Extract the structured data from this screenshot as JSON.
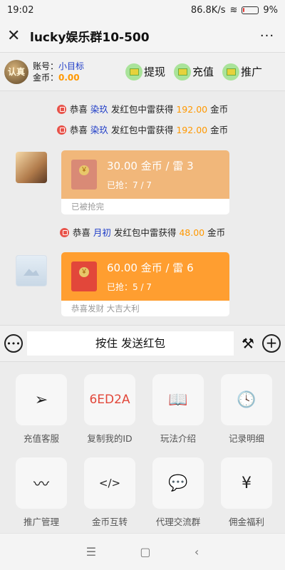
{
  "status": {
    "time": "19:02",
    "speed": "86.8K/s",
    "battery": "9%",
    "battery_level": 0.09
  },
  "header": {
    "title": "lucky娱乐群10-500",
    "close_glyph": "✕",
    "more_glyph": "···"
  },
  "account": {
    "avatar_text": "认真",
    "account_label": "账号：",
    "account_name": "小目标",
    "coin_label": "金币：",
    "coin_value": "0.00",
    "withdraw": "提现",
    "recharge": "充值",
    "promote": "推广"
  },
  "notices": [
    {
      "pre": "恭喜 ",
      "name": "染玖",
      "mid": " 发红包中雷获得 ",
      "amount": "192.00",
      "unit": " 金币"
    },
    {
      "pre": "恭喜 ",
      "name": "染玖",
      "mid": " 发红包中雷获得 ",
      "amount": "192.00",
      "unit": " 金币"
    },
    {
      "pre": "恭喜 ",
      "name": "月初",
      "mid": " 发红包中雷获得 ",
      "amount": "48.00",
      "unit": " 金币"
    }
  ],
  "packets": [
    {
      "title": "30.00 金币 / 雷 3",
      "grabbed": "已抢：7 / 7",
      "footer": "已被抢完"
    },
    {
      "title": "60.00 金币 / 雷 6",
      "grabbed": "已抢：5 / 7",
      "footer": "恭喜发财 大吉大利"
    }
  ],
  "input": {
    "hold_label": "按住 发送红包"
  },
  "grid": [
    {
      "label": "充值客服",
      "icon": "paper-plane-icon",
      "glyph": "➢"
    },
    {
      "label": "复制我的ID",
      "icon": "id-text",
      "glyph": "6ED2A"
    },
    {
      "label": "玩法介绍",
      "icon": "book-icon",
      "glyph": "📖"
    },
    {
      "label": "记录明细",
      "icon": "clock-icon",
      "glyph": "🕓"
    },
    {
      "label": "推广管理",
      "icon": "pulse-icon",
      "glyph": "〰"
    },
    {
      "label": "金币互转",
      "icon": "code-icon",
      "glyph": "</>"
    },
    {
      "label": "代理交流群",
      "icon": "wechat-icon",
      "glyph": "💬"
    },
    {
      "label": "佣金福利",
      "icon": "yen-icon",
      "glyph": "¥"
    }
  ],
  "nav": {
    "menu": "☰",
    "home": "▢",
    "back": "‹"
  }
}
